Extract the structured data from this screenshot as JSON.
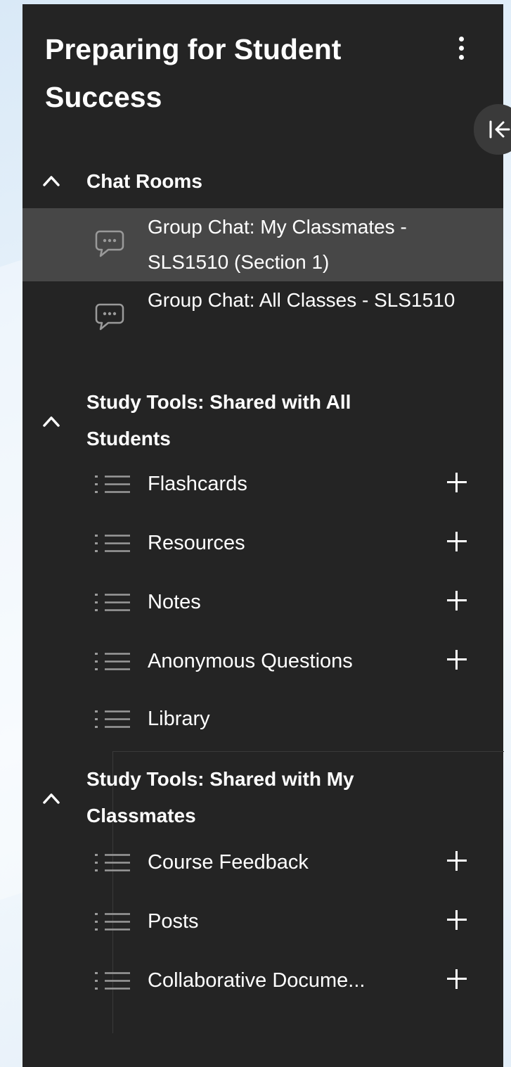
{
  "panel": {
    "title": "Preparing for Student Success",
    "collapse_icon": "collapse-left-icon",
    "menu_icon": "kebab-menu-icon"
  },
  "chat_rooms": {
    "title": "Chat Rooms",
    "items": [
      {
        "label": "Group Chat: My Classmates - SLS1510 (Section 1)",
        "selected": true
      },
      {
        "label": "Group Chat: All Classes - SLS1510",
        "selected": false
      }
    ]
  },
  "study_all": {
    "title": "Study Tools: Shared with All Students",
    "items": [
      {
        "label": "Flashcards",
        "has_add": true
      },
      {
        "label": "Resources",
        "has_add": true
      },
      {
        "label": "Notes",
        "has_add": true
      },
      {
        "label": "Anonymous Questions",
        "has_add": true
      },
      {
        "label": "Library",
        "has_add": false
      }
    ]
  },
  "study_classmates": {
    "title": "Study Tools: Shared with My Classmates",
    "items": [
      {
        "label": "Course Feedback",
        "has_add": true
      },
      {
        "label": "Posts",
        "has_add": true
      },
      {
        "label": "Collaborative Docume...",
        "has_add": true
      }
    ]
  },
  "colors": {
    "panel_bg": "#242424",
    "selected_bg": "#474747",
    "icon_gray": "#9a9a9a",
    "text": "#ffffff"
  }
}
